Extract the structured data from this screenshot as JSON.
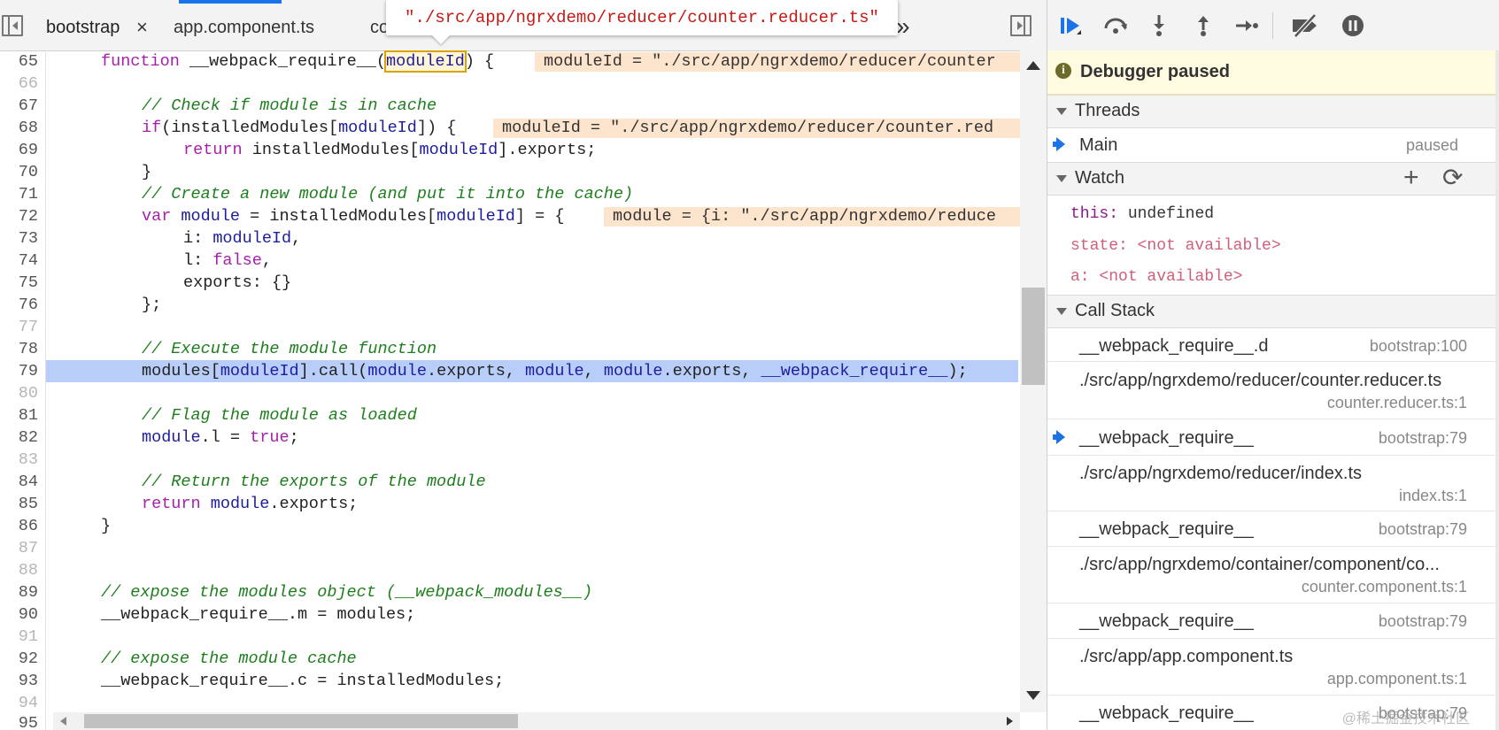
{
  "editor": {
    "tabs": [
      {
        "label": "bootstrap",
        "close": "×",
        "active": true
      },
      {
        "label": "app.component.ts",
        "active": false
      },
      {
        "label": "co",
        "active": false
      }
    ],
    "overflow_glyph": "»",
    "tooltip": "\"./src/app/ngrxdemo/reducer/counter.reducer.ts\"",
    "lines": [
      {
        "n": "65"
      },
      {
        "n": "66"
      },
      {
        "n": "67"
      },
      {
        "n": "68"
      },
      {
        "n": "69"
      },
      {
        "n": "70"
      },
      {
        "n": "71"
      },
      {
        "n": "72"
      },
      {
        "n": "73"
      },
      {
        "n": "74"
      },
      {
        "n": "75"
      },
      {
        "n": "76"
      },
      {
        "n": "77"
      },
      {
        "n": "78"
      },
      {
        "n": "79"
      },
      {
        "n": "80"
      },
      {
        "n": "81"
      },
      {
        "n": "82"
      },
      {
        "n": "83"
      },
      {
        "n": "84"
      },
      {
        "n": "85"
      },
      {
        "n": "86"
      },
      {
        "n": "87"
      },
      {
        "n": "88"
      },
      {
        "n": "89"
      },
      {
        "n": "90"
      },
      {
        "n": "91"
      },
      {
        "n": "92"
      },
      {
        "n": "93"
      },
      {
        "n": "94"
      },
      {
        "n": "95"
      }
    ],
    "code": {
      "l65_fn": "function",
      "l65_name": "__webpack_require__",
      "l65_open": "(",
      "l65_arg": "moduleId",
      "l65_close": ") {",
      "l65_inline": "moduleId = \"./src/app/ngrxdemo/reducer/counter",
      "l67": "// Check if module is in cache",
      "l68_if": "if",
      "l68_a": "(installedModules[",
      "l68_b": "moduleId",
      "l68_c": "]) {",
      "l68_inline": "moduleId = \"./src/app/ngrxdemo/reducer/counter.red",
      "l69_ret": "return",
      "l69_a": " installedModules[",
      "l69_b": "moduleId",
      "l69_c": "].exports;",
      "l70": "}",
      "l71": "// Create a new module (and put it into the cache)",
      "l72_var": "var",
      "l72_mod": "module",
      "l72_eq": " = installedModules[",
      "l72_id": "moduleId",
      "l72_end": "] = {",
      "l72_inline": "module = {i: \"./src/app/ngrxdemo/reduce",
      "l73_a": "i: ",
      "l73_b": "moduleId",
      "l73_c": ",",
      "l74_a": "l: ",
      "l74_b": "false",
      "l74_c": ",",
      "l75": "exports: {}",
      "l76": "};",
      "l78": "// Execute the module function",
      "l79_a": "modules[",
      "l79_b": "moduleId",
      "l79_c": "].call(",
      "l79_d": "module",
      "l79_e": ".exports, ",
      "l79_f": "module",
      "l79_g": ", ",
      "l79_h": "module",
      "l79_i": ".exports, ",
      "l79_j": "__webpack_require__",
      "l79_k": ");",
      "l81": "// Flag the module as loaded",
      "l82_a": "module",
      "l82_b": ".l = ",
      "l82_c": "true",
      "l82_d": ";",
      "l84": "// Return the exports of the module",
      "l85_ret": "return",
      "l85_a": " ",
      "l85_b": "module",
      "l85_c": ".exports;",
      "l86": "}",
      "l89": "// expose the modules object (__webpack_modules__)",
      "l90_a": "__webpack_require__.m = modules;",
      "l92": "// expose the module cache",
      "l93_a": "__webpack_require__.c = installedModules;"
    }
  },
  "debugger": {
    "paused_icon": "i",
    "paused_text": "Debugger paused",
    "threads": {
      "title": "Threads",
      "items": [
        {
          "name": "Main",
          "status": "paused"
        }
      ]
    },
    "watch": {
      "title": "Watch",
      "add_glyph": "+",
      "refresh_glyph": "⟳",
      "items": [
        {
          "key": "this:",
          "value": "undefined"
        },
        {
          "key": "state:",
          "value": "<not available>"
        },
        {
          "key": "a:",
          "value": "<not available>"
        }
      ]
    },
    "call_stack": {
      "title": "Call Stack",
      "frames": [
        {
          "name": "__webpack_require__.d",
          "location": "bootstrap:100"
        },
        {
          "name": "./src/app/ngrxdemo/reducer/counter.reducer.ts",
          "location": "counter.reducer.ts:1"
        },
        {
          "name": "__webpack_require__",
          "location": "bootstrap:79"
        },
        {
          "name": "./src/app/ngrxdemo/reducer/index.ts",
          "location": "index.ts:1"
        },
        {
          "name": "__webpack_require__",
          "location": "bootstrap:79"
        },
        {
          "name": "./src/app/ngrxdemo/container/component/co...",
          "location": "counter.component.ts:1"
        },
        {
          "name": "__webpack_require__",
          "location": "bootstrap:79"
        },
        {
          "name": "./src/app/app.component.ts",
          "location": "app.component.ts:1"
        },
        {
          "name": "__webpack_require__",
          "location": "bootstrap:79"
        }
      ]
    }
  },
  "watermark": "@稀土掘金技术社区",
  "colors": {
    "accent": "#1a73e8",
    "current_line": "#b8cdf7",
    "inline_value_bg": "#fde4cc",
    "paused_banner": "#fffbe1",
    "keyword": "#a61fab",
    "comment": "#1e7e1e",
    "string": "#c41a16"
  }
}
